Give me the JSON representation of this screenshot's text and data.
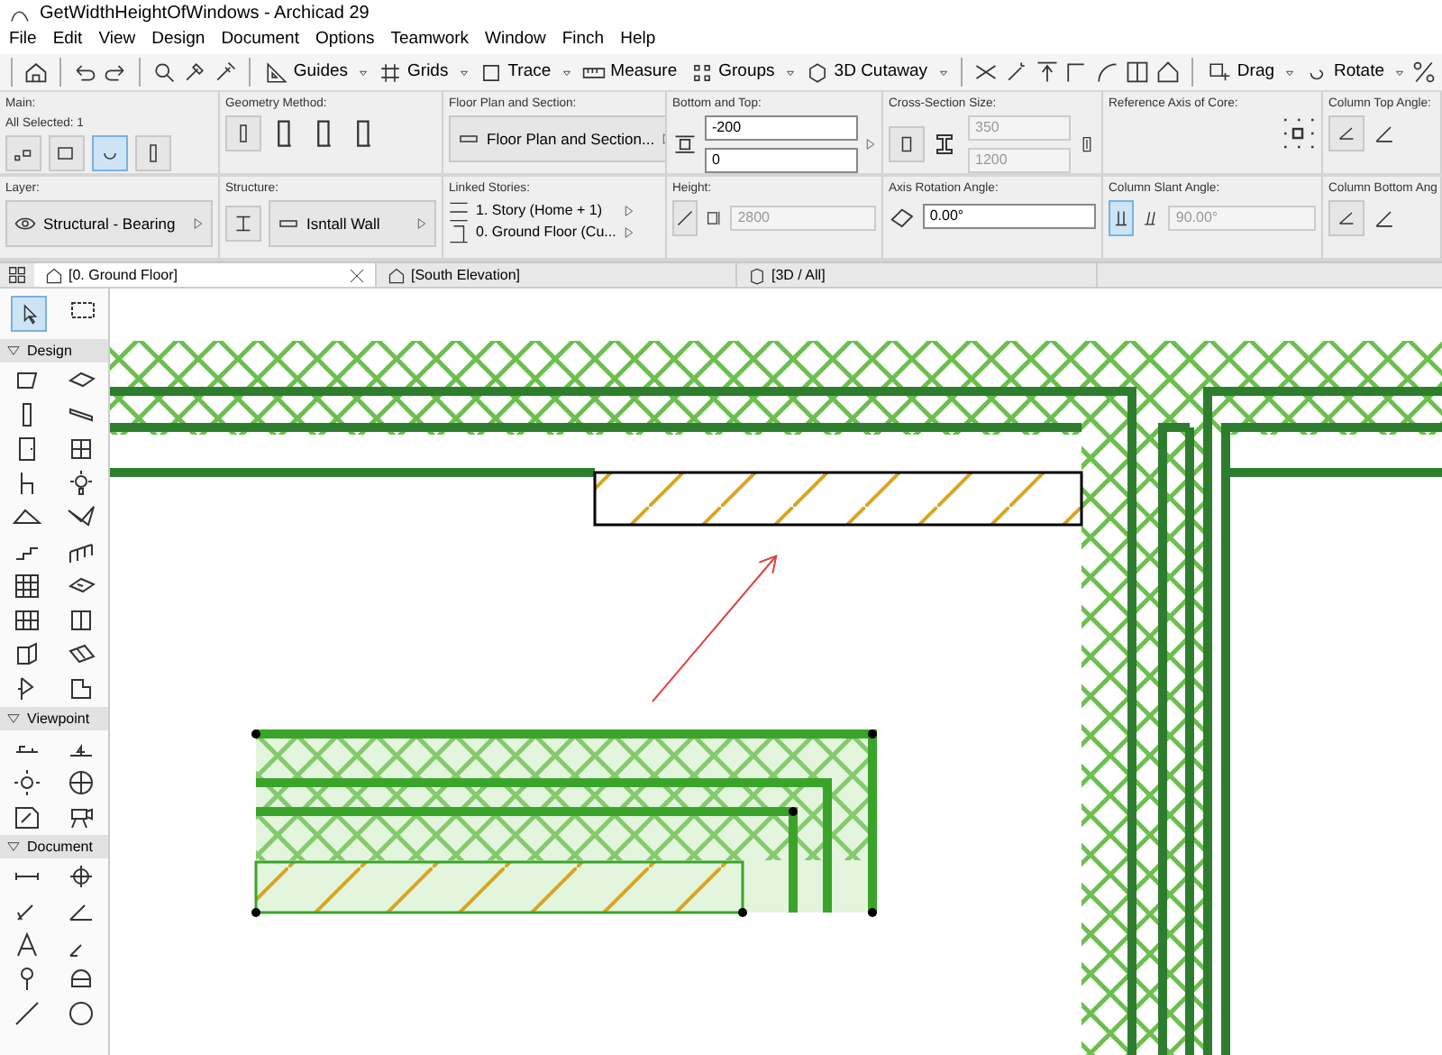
{
  "window": {
    "title": "GetWidthHeightOfWindows - Archicad 29"
  },
  "menu": [
    "File",
    "Edit",
    "View",
    "Design",
    "Document",
    "Options",
    "Teamwork",
    "Window",
    "Finch",
    "Help"
  ],
  "toolbar": [
    {
      "label": "Guides",
      "dropdown": true
    },
    {
      "label": "Grids",
      "dropdown": true
    },
    {
      "label": "Trace",
      "dropdown": true
    },
    {
      "label": "Measure",
      "dropdown": false
    },
    {
      "label": "Groups",
      "dropdown": true
    },
    {
      "label": "3D Cutaway",
      "dropdown": true
    },
    {
      "label": "Drag",
      "dropdown": true
    },
    {
      "label": "Rotate",
      "dropdown": true
    }
  ],
  "info_box": {
    "rows": [
      [
        {
          "kind": "main",
          "label": "Main:",
          "caption": "All Selected: 1"
        },
        {
          "kind": "geometry",
          "label": "Geometry Method:"
        },
        {
          "kind": "popup",
          "label": "Floor Plan and Section:",
          "value": "Floor Plan and Section..."
        },
        {
          "kind": "bottom_top",
          "label": "Bottom and Top:",
          "fields": [
            "-200",
            "0"
          ]
        },
        {
          "kind": "size",
          "label": "Cross-Section Size:",
          "fields": [
            "350",
            "1200"
          ],
          "disabled": true
        },
        {
          "kind": "axis",
          "label": "Reference Axis of Core:"
        },
        {
          "kind": "angle",
          "label": "Column Top Angle:"
        }
      ],
      [
        {
          "kind": "layer",
          "label": "Layer:",
          "value": "Structural - Bearing"
        },
        {
          "kind": "structure",
          "label": "Structure:",
          "value": "Isntall Wall"
        },
        {
          "kind": "stories",
          "label": "Linked Stories:",
          "stories": [
            "1. Story (Home + 1)",
            "0. Ground Floor (Cu..."
          ]
        },
        {
          "kind": "height",
          "label": "Height:",
          "value": "2800",
          "disabled": true
        },
        {
          "kind": "field",
          "label": "Axis Rotation Angle:",
          "value": "0.00°"
        },
        {
          "kind": "slant",
          "label": "Column Slant Angle:",
          "value": "90.00°",
          "disabled": true
        },
        {
          "kind": "angle",
          "label": "Column Bottom Ang"
        }
      ]
    ]
  },
  "tabs": [
    {
      "label": "[0. Ground Floor]",
      "selected": true,
      "closable": true
    },
    {
      "label": "[South Elevation]",
      "selected": false,
      "closable": false
    },
    {
      "label": "[3D / All]",
      "selected": false,
      "closable": false
    }
  ],
  "toolbox": {
    "sections": [
      {
        "label": "Design",
        "expanded": true
      },
      {
        "label": "Viewpoint",
        "expanded": true
      },
      {
        "label": "Document",
        "expanded": true
      }
    ]
  }
}
